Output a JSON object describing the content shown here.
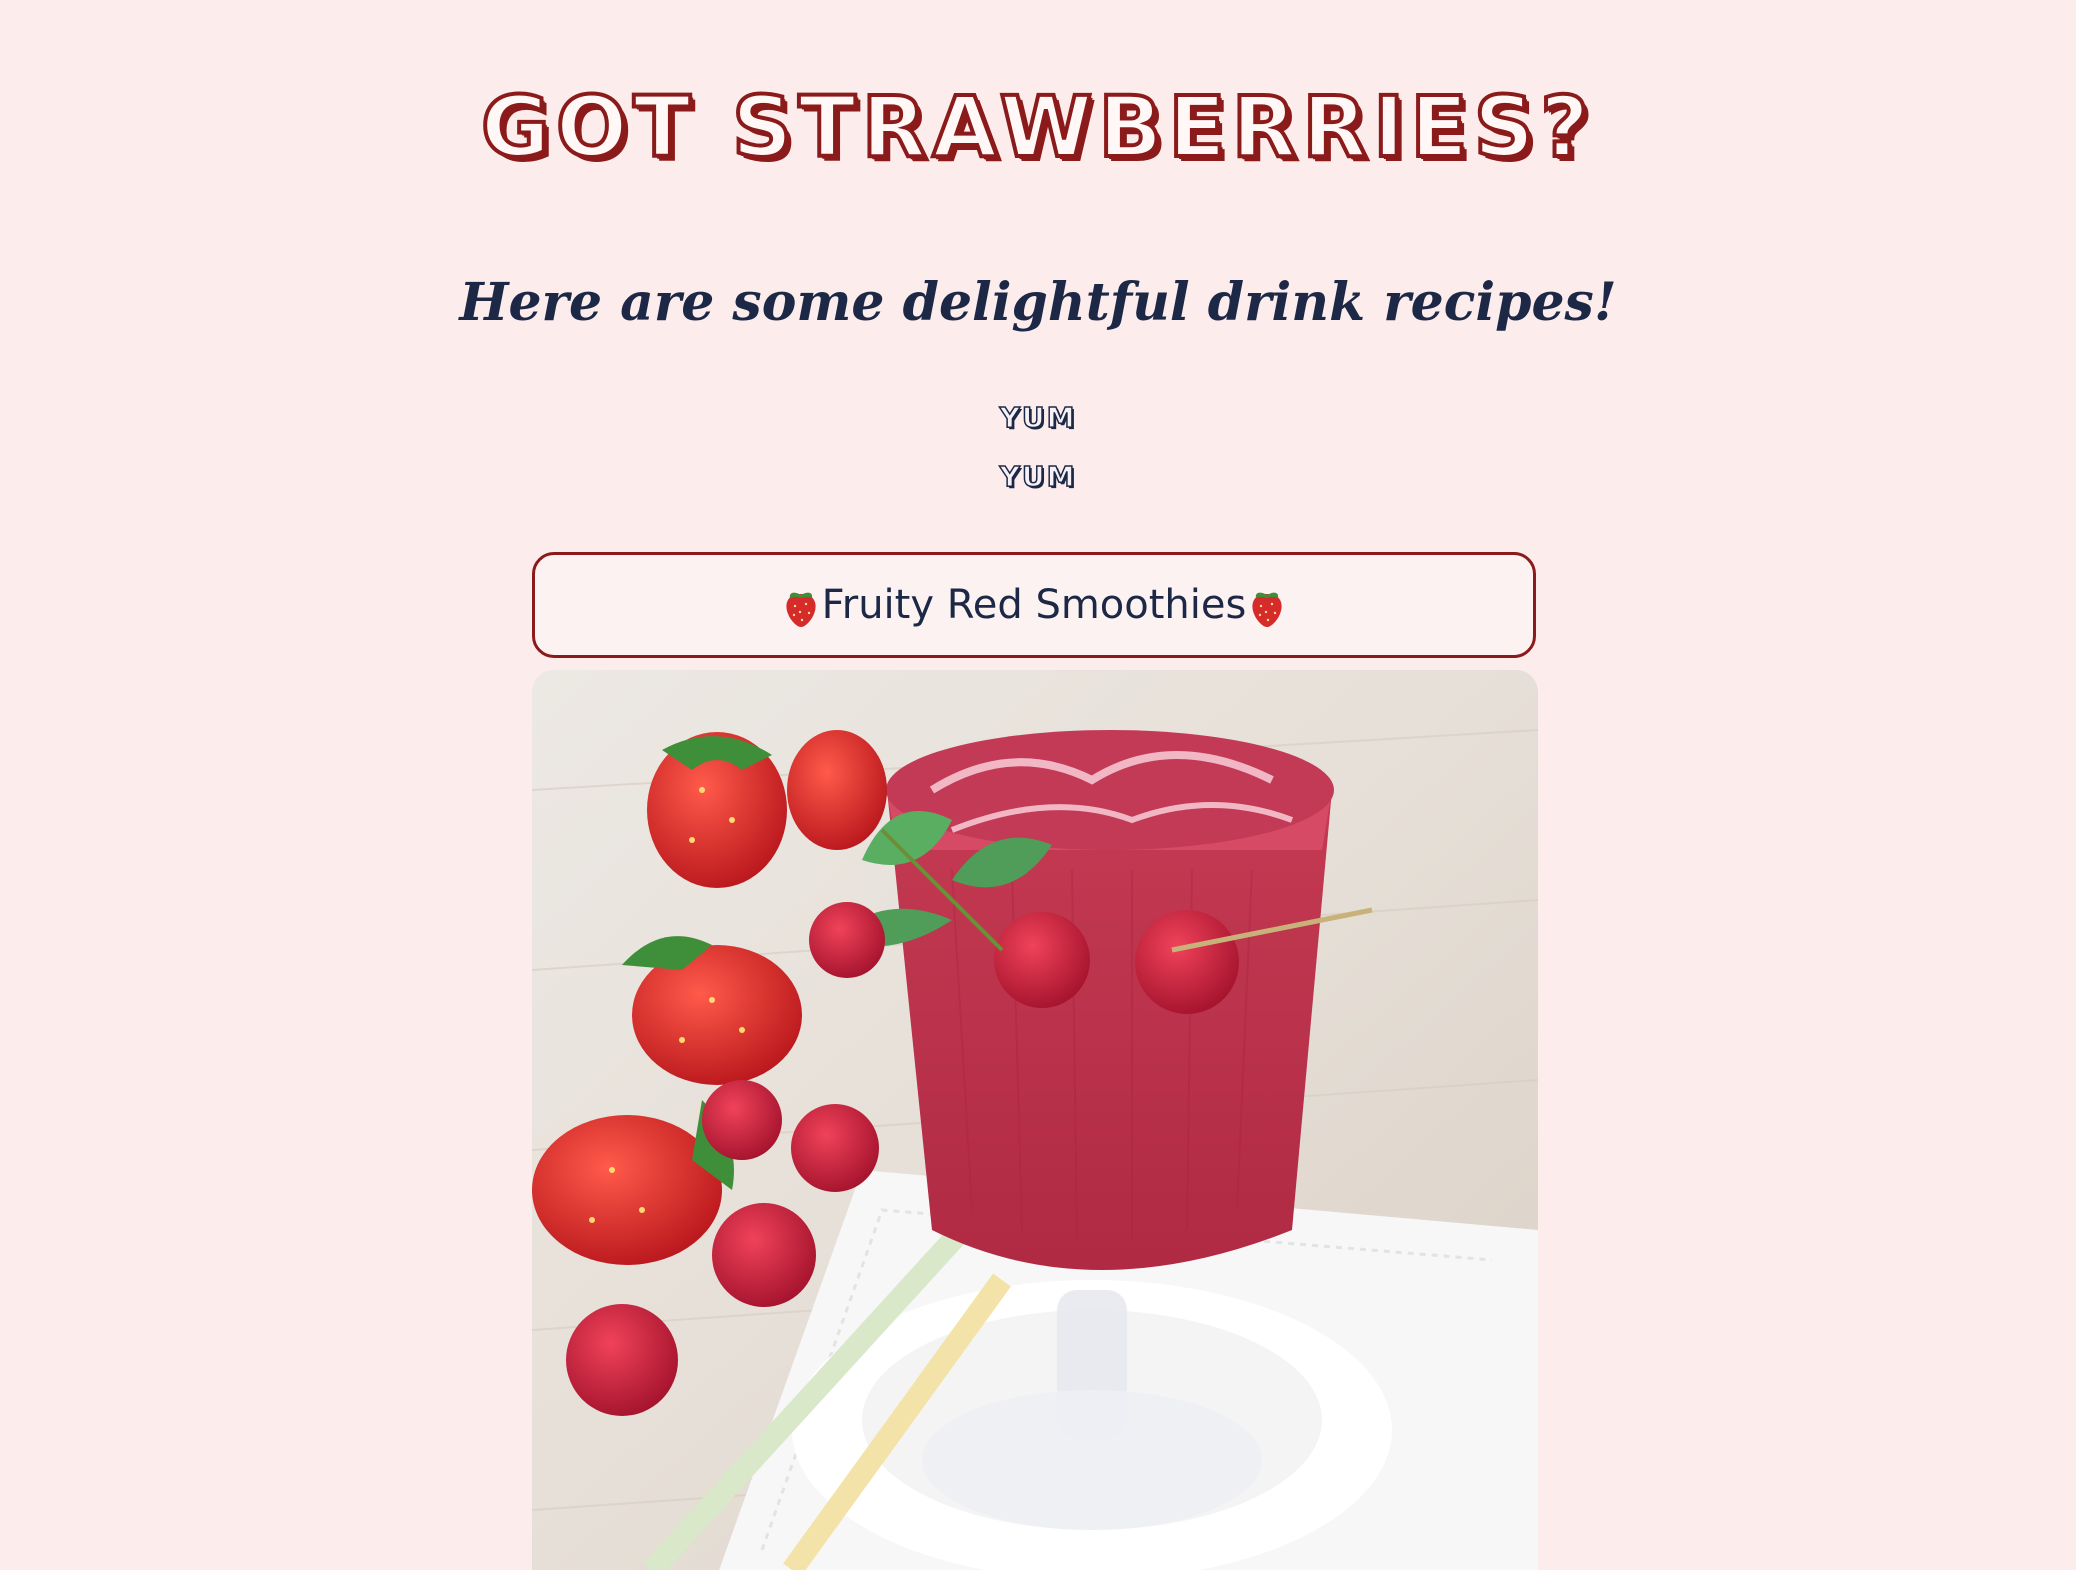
{
  "header": {
    "title": "Got Strawberries?",
    "subtitle": "Here are some delightful drink recipes!",
    "tagline_lines": [
      "yum",
      "yum"
    ]
  },
  "recipe": {
    "button_label": "Fruity Red Smoothies",
    "leading_icon": "strawberry-icon",
    "trailing_icon": "strawberry-icon"
  },
  "colors": {
    "background": "#fcecec",
    "accent_red": "#8b1a1a",
    "navy_text": "#1c2845"
  }
}
